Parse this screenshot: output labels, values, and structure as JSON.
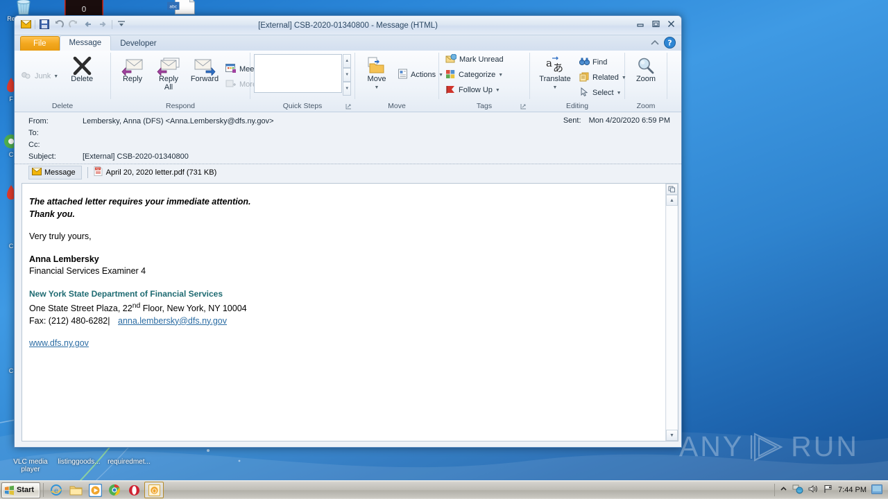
{
  "desktop": {
    "top_icons": [
      {
        "name": "recycle-bin",
        "label": ""
      },
      {
        "name": "unknown-dark-icon",
        "label": "0"
      },
      {
        "name": "text-file-icon",
        "label": ""
      }
    ],
    "left_icons": [
      {
        "label": "Re"
      },
      {
        "label": "F"
      },
      {
        "label": "C"
      },
      {
        "label": ""
      },
      {
        "label": "C"
      },
      {
        "label": ""
      },
      {
        "label": "C"
      }
    ],
    "bottom_icons": [
      {
        "label": "VLC media player"
      },
      {
        "label": "listinggoods..."
      },
      {
        "label": "requiredmet..."
      }
    ],
    "watermark": "ANY RUN"
  },
  "taskbar": {
    "start_label": "Start",
    "items": [
      {
        "name": "taskbar-internet-explorer",
        "active": false
      },
      {
        "name": "taskbar-windows-explorer",
        "active": false
      },
      {
        "name": "taskbar-media-player",
        "active": false
      },
      {
        "name": "taskbar-chrome",
        "active": false
      },
      {
        "name": "taskbar-opera",
        "active": false
      },
      {
        "name": "taskbar-outlook",
        "active": true
      }
    ],
    "tray": {
      "show_hidden": "show-hidden-icons",
      "network": "network-icon",
      "volume": "volume-icon",
      "flag": "action-center-flag-icon",
      "clock": "7:44 PM",
      "show_desktop": "show-desktop-button"
    }
  },
  "window": {
    "title": "[External] CSB-2020-01340800  -  Message (HTML)",
    "controls": {
      "minimize": "minimize-button",
      "maximize": "maximize-button",
      "close": "close-button"
    },
    "quick_access": [
      {
        "name": "envelope-icon"
      },
      {
        "name": "save-icon"
      },
      {
        "name": "undo-icon"
      },
      {
        "name": "redo-icon"
      },
      {
        "name": "previous-item-icon"
      },
      {
        "name": "next-item-icon"
      },
      {
        "name": "customize-qat-icon"
      }
    ],
    "tabs": {
      "file": "File",
      "items": [
        {
          "label": "Message",
          "selected": true
        },
        {
          "label": "Developer",
          "selected": false
        }
      ],
      "collapse_ribbon": "collapse-ribbon-icon",
      "help": "help-icon"
    }
  },
  "ribbon": {
    "groups": [
      {
        "label": "Delete",
        "buttons": [
          {
            "label": "Junk",
            "style": "small",
            "disabled": true,
            "caret": true,
            "icon": "junk-icon"
          },
          {
            "label": "Delete",
            "style": "big",
            "disabled": false,
            "caret": false,
            "icon": "delete-x-icon"
          }
        ]
      },
      {
        "label": "Respond",
        "buttons": [
          {
            "label": "Reply",
            "style": "big",
            "disabled": false,
            "caret": false,
            "icon": "reply-icon"
          },
          {
            "label": "Reply All",
            "style": "big",
            "disabled": false,
            "caret": false,
            "icon": "reply-all-icon"
          },
          {
            "label": "Forward",
            "style": "big",
            "disabled": false,
            "caret": false,
            "icon": "forward-icon"
          },
          {
            "label": "Meeting",
            "style": "small",
            "disabled": false,
            "caret": false,
            "icon": "meeting-icon"
          },
          {
            "label": "More",
            "style": "small",
            "disabled": true,
            "caret": true,
            "icon": "more-icon"
          }
        ]
      },
      {
        "label": "Quick Steps",
        "buttons": []
      },
      {
        "label": "Move",
        "buttons": [
          {
            "label": "Move",
            "style": "big",
            "disabled": false,
            "caret": true,
            "icon": "move-folder-icon"
          },
          {
            "label": "Actions",
            "style": "small",
            "disabled": false,
            "caret": true,
            "icon": "actions-icon"
          }
        ]
      },
      {
        "label": "Tags",
        "buttons": [
          {
            "label": "Mark Unread",
            "style": "small",
            "disabled": false,
            "caret": false,
            "icon": "mark-unread-icon"
          },
          {
            "label": "Categorize",
            "style": "small",
            "disabled": false,
            "caret": true,
            "icon": "categorize-icon"
          },
          {
            "label": "Follow Up",
            "style": "small",
            "disabled": false,
            "caret": true,
            "icon": "follow-up-flag-icon"
          }
        ]
      },
      {
        "label": "Editing",
        "buttons": [
          {
            "label": "Translate",
            "style": "big",
            "disabled": false,
            "caret": true,
            "icon": "translate-icon"
          },
          {
            "label": "Find",
            "style": "small",
            "disabled": false,
            "caret": false,
            "icon": "find-binoculars-icon"
          },
          {
            "label": "Related",
            "style": "small",
            "disabled": false,
            "caret": true,
            "icon": "related-icon"
          },
          {
            "label": "Select",
            "style": "small",
            "disabled": false,
            "caret": true,
            "icon": "select-pointer-icon"
          }
        ]
      },
      {
        "label": "Zoom",
        "buttons": [
          {
            "label": "Zoom",
            "style": "big",
            "disabled": false,
            "caret": false,
            "icon": "zoom-magnifier-icon"
          }
        ]
      }
    ]
  },
  "message": {
    "fields": [
      {
        "label": "From:",
        "value": "Lembersky, Anna (DFS) <Anna.Lembersky@dfs.ny.gov>"
      },
      {
        "label": "To:",
        "value": ""
      },
      {
        "label": "Cc:",
        "value": ""
      },
      {
        "label": "Subject:",
        "value": "[External] CSB-2020-01340800"
      }
    ],
    "sent_label": "Sent:",
    "sent_value": "Mon 4/20/2020 6:59 PM",
    "message_tab": "Message",
    "attachment": "April 20, 2020 letter.pdf (731 KB)",
    "body": {
      "line1": "The attached letter requires your immediate attention.",
      "line2": "Thank you.",
      "line3": "Very truly yours,",
      "name": "Anna Lembersky",
      "job_title": "Financial Services Examiner 4",
      "org": "New York State Department of Financial Services",
      "address_pre": "One State Street Plaza, 22",
      "address_sup": "nd",
      "address_post": " Floor, New York, NY 10004",
      "fax": "Fax: (212) 480-6282|",
      "email": "anna.lembersky@dfs.ny.gov",
      "website": "www.dfs.ny.gov"
    }
  },
  "colors": {
    "accent_orange": "#f3a81f",
    "teal": "#1f6b72",
    "link_blue": "#2b6ca3",
    "desktop_blue": "#2a86d8"
  }
}
